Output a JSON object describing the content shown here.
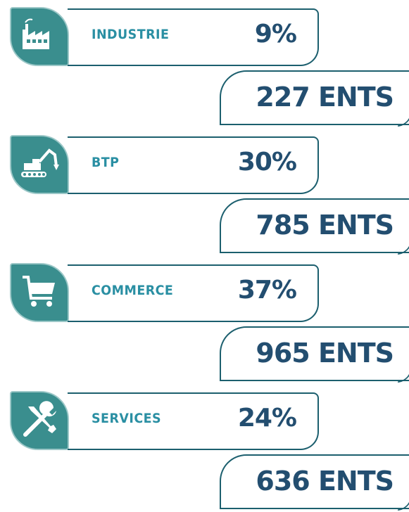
{
  "accent_color": "#3a8e8e",
  "label_color": "#2a8fa3",
  "value_color": "#234e70",
  "rows": [
    {
      "icon": "factory-icon",
      "label": "INDUSTRIE",
      "percent": "9%",
      "count": "227 ENTS"
    },
    {
      "icon": "excavator-icon",
      "label": "BTP",
      "percent": "30%",
      "count": "785 ENTS"
    },
    {
      "icon": "shopping-cart-icon",
      "label": "COMMERCE",
      "percent": "37%",
      "count": "965 ENTS"
    },
    {
      "icon": "tools-icon",
      "label": "SERVICES",
      "percent": "24%",
      "count": "636 ENTS"
    }
  ]
}
